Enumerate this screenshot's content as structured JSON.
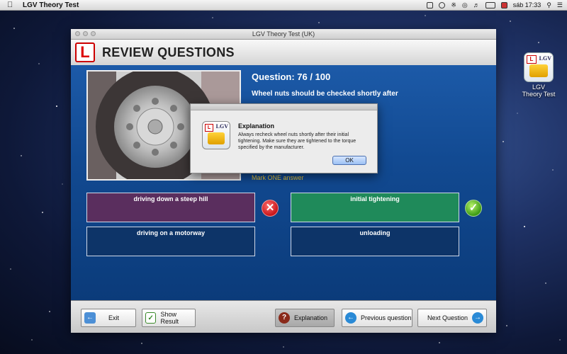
{
  "menubar": {
    "app_name": "LGV Theory Test",
    "clock": "sáb 17:33"
  },
  "desktop_icon": {
    "label": "LGV Theory Test",
    "badge": "LGV"
  },
  "window": {
    "title": "LGV Theory Test (UK)",
    "header": {
      "plate": "L",
      "title": "REVIEW QUESTIONS"
    },
    "question": {
      "number": "Question: 76 / 100",
      "text": "Wheel nuts should be checked shortly after",
      "instruction": "Mark ONE answer"
    },
    "answers": [
      {
        "label": "driving down a steep hill",
        "state": "wrong"
      },
      {
        "label": "initial tightening",
        "state": "correct"
      },
      {
        "label": "driving on a motorway",
        "state": "none"
      },
      {
        "label": "unloading",
        "state": "none"
      }
    ],
    "toolbar": {
      "exit": "Exit",
      "show_result": "Show Result",
      "explanation": "Explanation",
      "previous": "Previous question",
      "next": "Next Question"
    }
  },
  "dialog": {
    "title": "Explanation",
    "body": "Always recheck wheel nuts shortly after their initial tightening. Make sure they are tightened to the torque specified by the manufacturer.",
    "ok": "OK",
    "icon_badge": "LGV"
  }
}
